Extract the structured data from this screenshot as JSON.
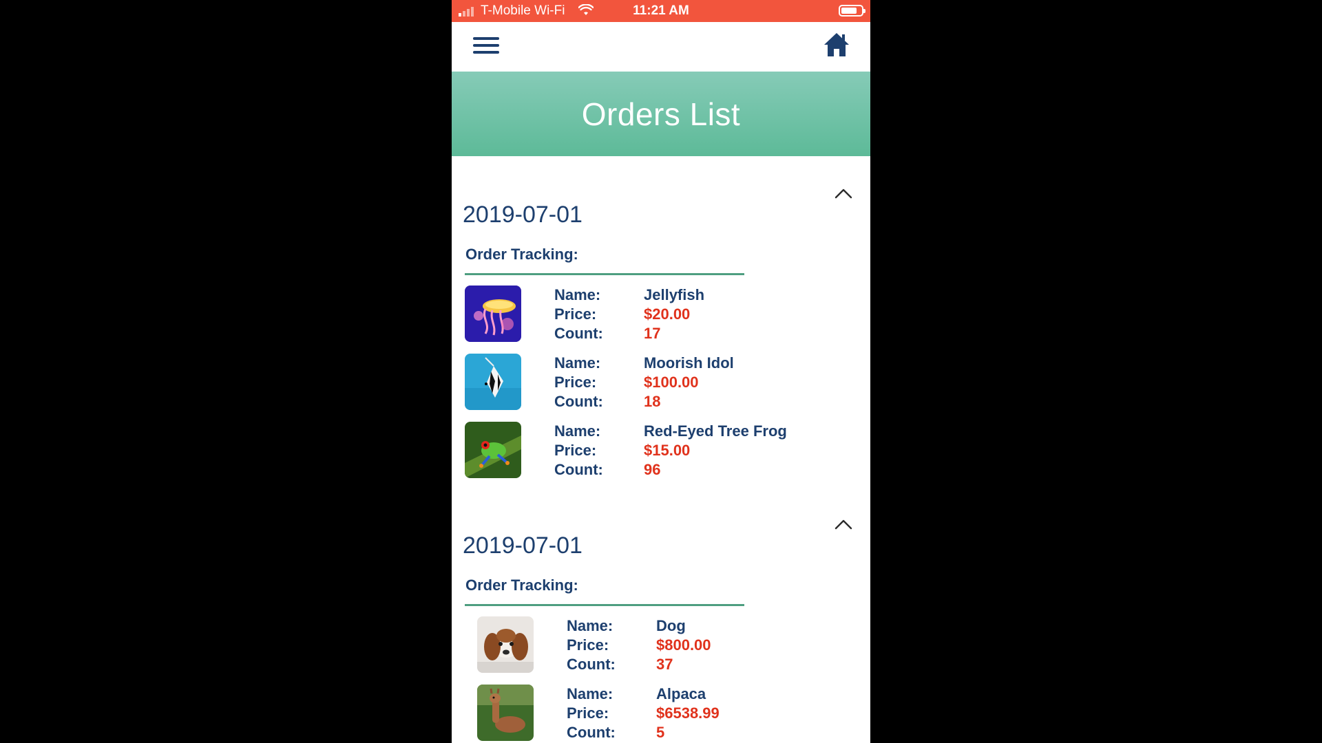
{
  "status_bar": {
    "carrier": "T-Mobile Wi-Fi",
    "time": "11:21 AM"
  },
  "nav": {
    "menu_icon": "hamburger-menu-icon",
    "home_icon": "home-icon"
  },
  "header": {
    "title": "Orders List",
    "gradient_top": "#86cbb7",
    "gradient_bottom": "#5dba98"
  },
  "labels": {
    "order_tracking": "Order Tracking:",
    "name": "Name:",
    "price": "Price:",
    "count": "Count:"
  },
  "orders": [
    {
      "date": "2019-07-01",
      "items": [
        {
          "name": "Jellyfish",
          "price": "$20.00",
          "count": "17"
        },
        {
          "name": "Moorish Idol",
          "price": "$100.00",
          "count": "18"
        },
        {
          "name": "Red-Eyed Tree Frog",
          "price": "$15.00",
          "count": "96"
        }
      ]
    },
    {
      "date": "2019-07-01",
      "items": [
        {
          "name": "Dog",
          "price": "$800.00",
          "count": "37"
        },
        {
          "name": "Alpaca",
          "price": "$6538.99",
          "count": "5"
        }
      ]
    }
  ],
  "colors": {
    "status_bar": "#f2553d",
    "primary_text": "#1d3f6e",
    "price_text": "#e0321c",
    "divider": "#4e9e80"
  }
}
